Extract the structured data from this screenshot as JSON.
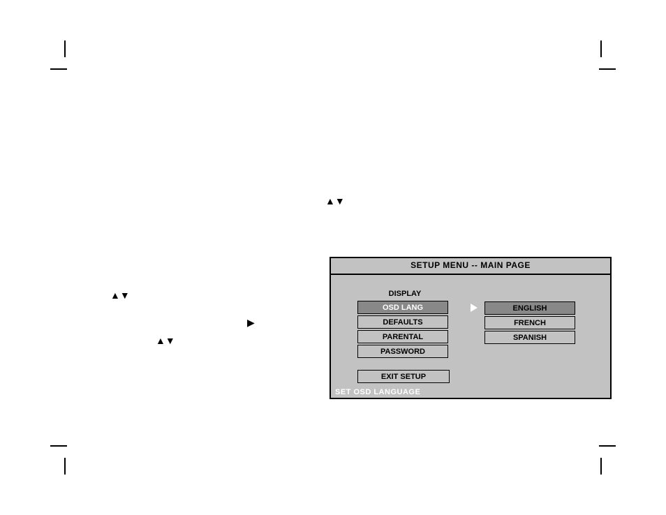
{
  "setup_menu": {
    "title": "SETUP MENU -- MAIN PAGE",
    "menu_items": {
      "display": "DISPLAY",
      "osd_lang": "OSD LANG",
      "defaults": "DEFAULTS",
      "parental": "PARENTAL",
      "password": "PASSWORD"
    },
    "submenu": {
      "english": "ENGLISH",
      "french": "FRENCH",
      "spanish": "SPANISH"
    },
    "exit": "EXIT SETUP",
    "status": "SET OSD LANGUAGE"
  },
  "glyphs": {
    "up_down": "▲▼",
    "right": "▶"
  }
}
